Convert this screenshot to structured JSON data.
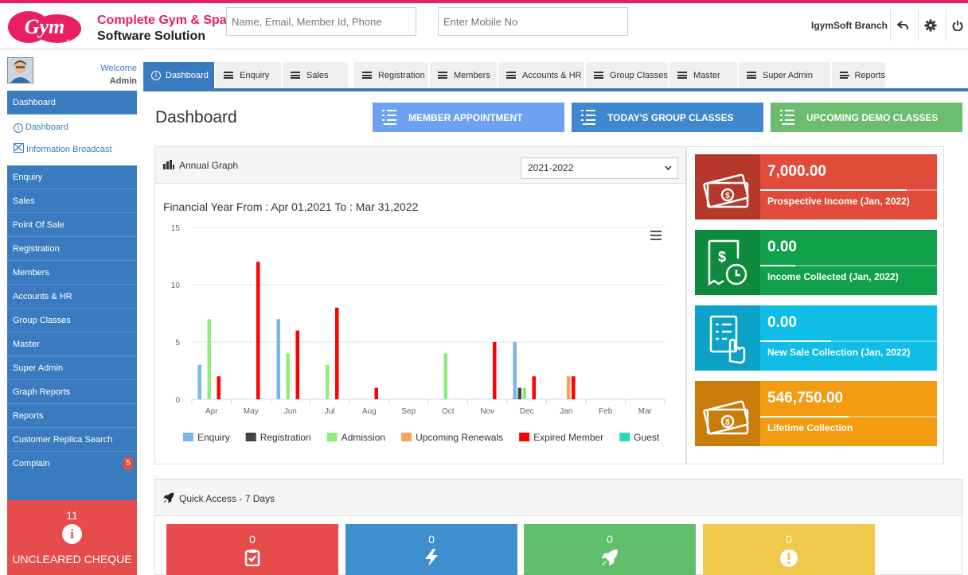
{
  "brand": {
    "logo_text": "Gym",
    "logo_sub": "Soft",
    "line1": "Complete Gym & Spa",
    "line2": "Software Solution"
  },
  "search": {
    "member_placeholder": "Name, Email, Member Id, Phone",
    "mobile_placeholder": "Enter Mobile No"
  },
  "header": {
    "branch": "IgymSoft Branch"
  },
  "welcome": {
    "greeting": "Welcome",
    "user": "Admin"
  },
  "tabs": [
    {
      "label": "Dashboard"
    },
    {
      "label": "Enquiry"
    },
    {
      "label": "Sales"
    },
    {
      "label": "Registration"
    },
    {
      "label": "Members"
    },
    {
      "label": "Accounts & HR"
    },
    {
      "label": "Group Classes"
    },
    {
      "label": "Master"
    },
    {
      "label": "Super Admin"
    },
    {
      "label": "Reports"
    }
  ],
  "sidebar": {
    "top": "Dashboard",
    "sub": [
      "Dashboard",
      "Information Broadcast"
    ],
    "items": [
      "Enquiry",
      "Sales",
      "Point Of Sale",
      "Registration",
      "Members",
      "Accounts & HR",
      "Group Classes",
      "Master",
      "Super Admin",
      "Graph Reports",
      "Reports",
      "Customer Replica Search",
      "Complain"
    ],
    "complain_badge": "5"
  },
  "cheque": {
    "count": "11",
    "label": "UNCLEARED CHEQUE"
  },
  "page_title": "Dashboard",
  "quick_buttons": [
    "MEMBER APPOINTMENT",
    "TODAY'S GROUP CLASSES",
    "UPCOMING DEMO CLASSES"
  ],
  "annual_graph": {
    "title": "Annual Graph",
    "year": "2021-2022"
  },
  "chart_data": {
    "type": "bar",
    "title": "Financial Year From : Apr 01,2021 To : Mar 31,2022",
    "categories": [
      "Apr",
      "May",
      "Jun",
      "Jul",
      "Aug",
      "Sep",
      "Oct",
      "Nov",
      "Dec",
      "Jan",
      "Feb",
      "Mar"
    ],
    "ylim": [
      0,
      15
    ],
    "yticks": [
      0,
      5,
      10,
      15
    ],
    "grid": true,
    "legend": "bottom",
    "series": [
      {
        "name": "Enquiry",
        "color": "#7cb5ec",
        "values": [
          3,
          0,
          7,
          0,
          0,
          0,
          0,
          0,
          5,
          0,
          0,
          0
        ]
      },
      {
        "name": "Registration",
        "color": "#434348",
        "values": [
          0,
          0,
          0,
          0,
          0,
          0,
          0,
          0,
          1,
          0,
          0,
          0
        ]
      },
      {
        "name": "Admission",
        "color": "#90ed7d",
        "values": [
          7,
          0,
          4,
          3,
          0,
          0,
          4,
          0,
          1,
          0,
          0,
          0
        ]
      },
      {
        "name": "Upcoming Renewals",
        "color": "#f7a35c",
        "values": [
          0,
          0,
          0,
          0,
          0,
          0,
          0,
          0,
          0,
          2,
          0,
          0
        ]
      },
      {
        "name": "Expired Member",
        "color": "#ff0000",
        "values": [
          2,
          12,
          6,
          8,
          1,
          0,
          0,
          5,
          2,
          2,
          0,
          0
        ]
      },
      {
        "name": "Guest",
        "color": "#2bd9c0",
        "values": [
          0,
          0,
          0,
          0,
          0,
          0,
          0,
          0,
          0,
          0,
          0,
          0
        ]
      }
    ]
  },
  "stats": [
    {
      "value": "7,000.00",
      "label": "Prospective Income (Jan, 2022)",
      "color": "#e04b3a",
      "dark": "#b5382a",
      "progress": 0.83
    },
    {
      "value": "0.00",
      "label": "Income Collected (Jan, 2022)",
      "color": "#12a14b",
      "dark": "#0e8a3f",
      "progress": 0.2
    },
    {
      "value": "0.00",
      "label": "New Sale Collection (Jan, 2022)",
      "color": "#0fbde6",
      "dark": "#0aa3c7",
      "progress": 0.4
    },
    {
      "value": "546,750.00",
      "label": "Lifetime Collection",
      "color": "#f39c12",
      "dark": "#c87d0a",
      "progress": 0.5
    }
  ],
  "quick_access": {
    "title": "Quick Access - 7 Days",
    "boxes": [
      {
        "count": "0",
        "color": "#e74c4c"
      },
      {
        "count": "0",
        "color": "#3f8fcf"
      },
      {
        "count": "0",
        "color": "#5fbf6a"
      },
      {
        "count": "0",
        "color": "#f0c94c"
      }
    ]
  }
}
